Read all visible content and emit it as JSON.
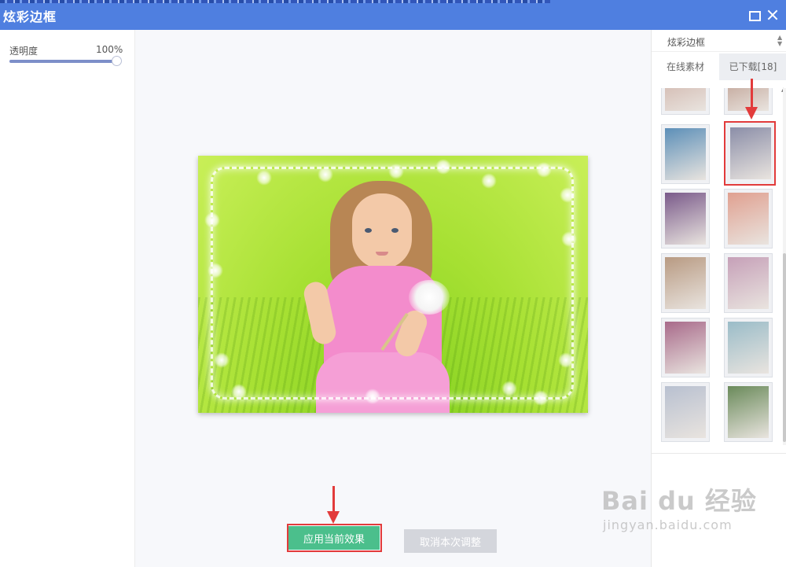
{
  "window": {
    "title": "炫彩边框"
  },
  "left_panel": {
    "opacity_label": "透明度",
    "opacity_value": "100%",
    "opacity_level": 1.0
  },
  "canvas": {
    "apply_button": "应用当前效果",
    "cancel_button": "取消本次调整"
  },
  "right_panel": {
    "category_select": "炫彩边框",
    "tabs": {
      "online": "在线素材",
      "downloaded": "已下载[18]"
    },
    "thumbnails": [
      {
        "color": "#c8a59a"
      },
      {
        "color": "#b08878"
      },
      {
        "color": "#5c8fb8"
      },
      {
        "color": "#8b8ea8"
      },
      {
        "color": "#7a5a8a"
      },
      {
        "color": "#e0a090"
      },
      {
        "color": "#b89a82"
      },
      {
        "color": "#c6a0b8"
      },
      {
        "color": "#a86a8a"
      },
      {
        "color": "#9abcc8"
      },
      {
        "color": "#b8c0d0"
      },
      {
        "color": "#6a8a5a"
      }
    ]
  },
  "watermark": {
    "main": "Bai du 经验",
    "sub": "jingyan.baidu.com"
  },
  "colors": {
    "titlebar": "#4f7fe0",
    "apply": "#4bbf8c",
    "cancel": "#d4d6dc",
    "annotation_red": "#e23b3b"
  }
}
